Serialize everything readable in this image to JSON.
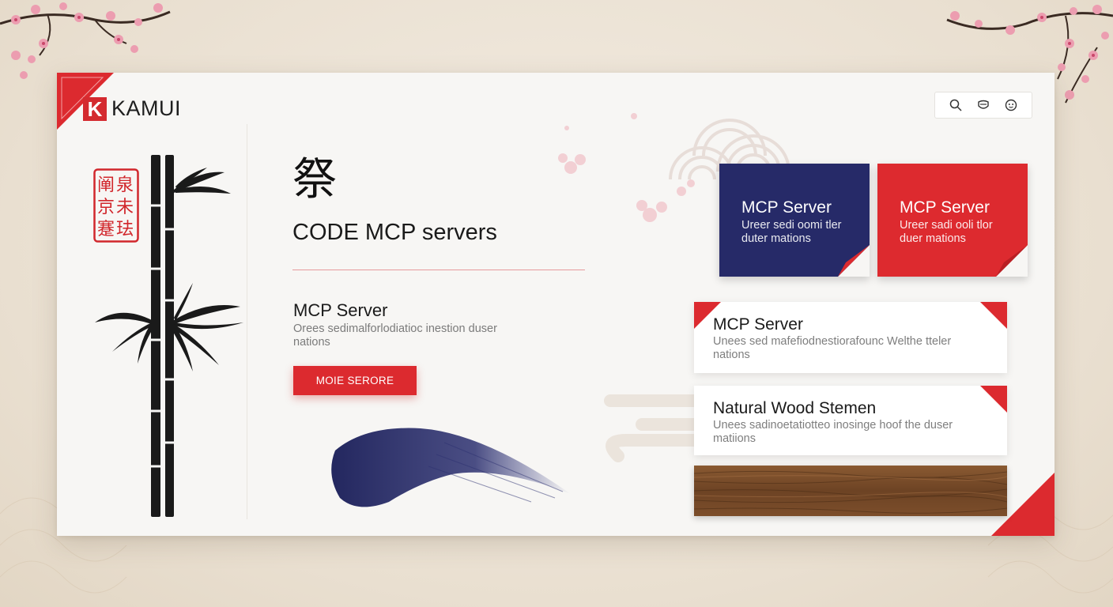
{
  "brand": {
    "mark": "K",
    "name": "KAMUI"
  },
  "toolbar": {
    "icons": [
      "search-icon",
      "mask-icon",
      "face-icon"
    ]
  },
  "seal": {
    "glyphs": [
      "阐",
      "泉",
      "京",
      "未",
      "蹇",
      "珐"
    ]
  },
  "hero": {
    "kanji": "祭",
    "title": "CODE MCP servers"
  },
  "feature": {
    "title": "MCP Server",
    "desc": "Orees sedimalforlodiatioc inestion duser nations",
    "button": "MOIE SERORE"
  },
  "tiles": [
    {
      "title": "MCP Server",
      "desc": "Ureer sedi oomi tler duter mations",
      "color": "#262a68"
    },
    {
      "title": "MCP Server",
      "desc": "Ureer sadi ooli tlor duer mations",
      "color": "#dd2a2f"
    }
  ],
  "list": [
    {
      "title": "MCP Server",
      "desc": "Unees sed mafefiodnestiorafounc Welthe tteler nations"
    },
    {
      "title": "Natural Wood Stemen",
      "desc": "Unees sadinoetatiotteo inosinge hoof the duser matiions"
    }
  ],
  "colors": {
    "accent_red": "#dc2a2f",
    "navy": "#262a68",
    "paper": "#f7f6f4"
  }
}
